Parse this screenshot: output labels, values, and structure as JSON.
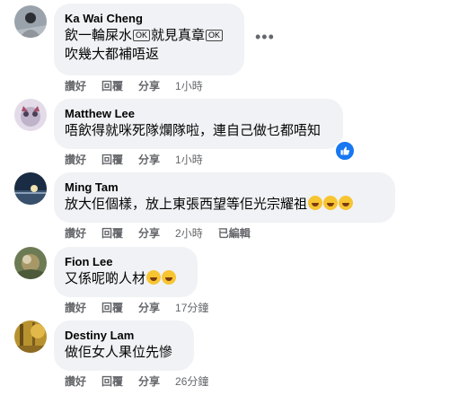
{
  "comments": [
    {
      "author": "Ka Wai Cheng",
      "line1a": "飲一輪屎水",
      "badge1": "OK",
      "line1b": "就見真章",
      "badge2": "OK",
      "line2": "吹幾大都補唔返",
      "like": "讚好",
      "reply": "回覆",
      "share": "分享",
      "time": "1小時"
    },
    {
      "author": "Matthew Lee",
      "text": "唔飲得就咪死隊爛隊啦，連自己做乜都唔知",
      "like": "讚好",
      "reply": "回覆",
      "share": "分享",
      "time": "1小時"
    },
    {
      "author": "Ming Tam",
      "text": "放大佢個樣，放上東張西望等佢光宗耀祖",
      "like": "讚好",
      "reply": "回覆",
      "share": "分享",
      "time": "2小時",
      "edited": "已編輯"
    },
    {
      "author": "Fion Lee",
      "text": "又係呢啲人材",
      "like": "讚好",
      "reply": "回覆",
      "share": "分享",
      "time": "17分鐘"
    },
    {
      "author": "Destiny Lam",
      "text": "做佢女人果位先慘",
      "like": "讚好",
      "reply": "回覆",
      "share": "分享",
      "time": "26分鐘"
    }
  ],
  "more_icon": "more-horizontal-icon",
  "reaction_icon": "like-reaction-icon",
  "colors": {
    "bubble": "#f0f2f5",
    "meta_text": "#65676b",
    "reaction": "#1877f2",
    "emoji": "#f7c532"
  }
}
